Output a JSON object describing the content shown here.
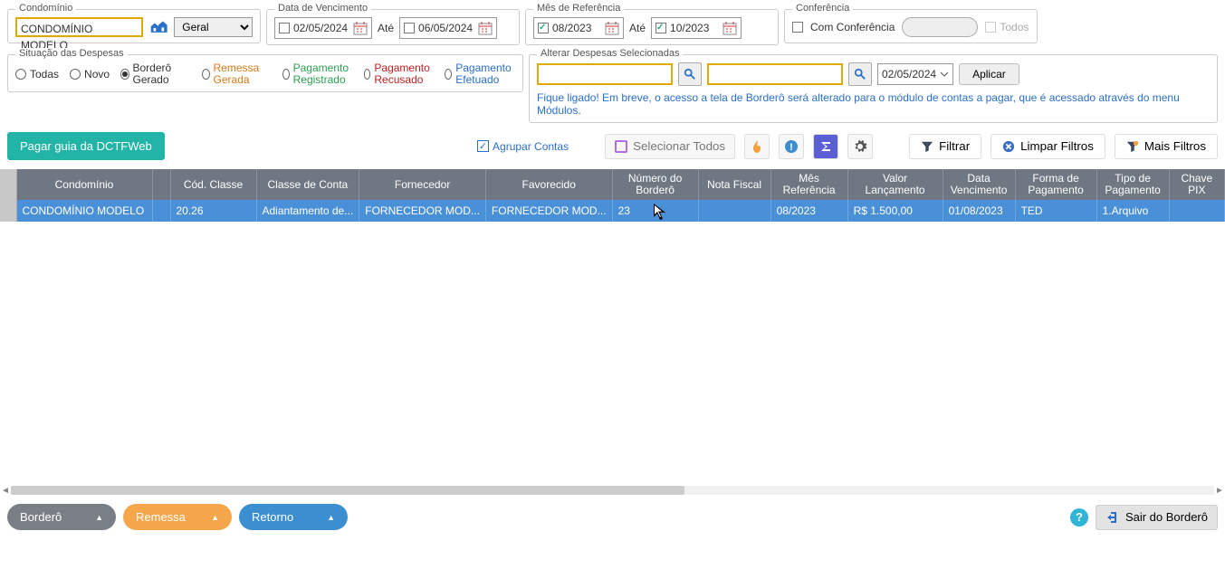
{
  "condominio": {
    "legend": "Condomínio",
    "name": "CONDOMÍNIO MODELO",
    "tipo": "Geral"
  },
  "dataVencimento": {
    "legend": "Data de Vencimento",
    "from": "02/05/2024",
    "to": "06/05/2024",
    "ate": "Até",
    "fromChecked": false,
    "toChecked": false
  },
  "mesReferencia": {
    "legend": "Mês de Referência",
    "from": "08/2023",
    "to": "10/2023",
    "ate": "Até"
  },
  "conferencia": {
    "legend": "Conferência",
    "label": "Com Conferência",
    "todos": "Todos"
  },
  "situacao": {
    "legend": "Situação das Despesas",
    "options": {
      "todas": "Todas",
      "novo": "Novo",
      "bordero": "Borderô Gerado",
      "remessa": "Remessa Gerada",
      "registrado": "Pagamento Registrado",
      "recusado": "Pagamento Recusado",
      "efetuado": "Pagamento Efetuado"
    },
    "selected": "bordero",
    "colors": {
      "remessa": "#d97b1c",
      "registrado": "#2a9f52",
      "recusado": "#c02020",
      "efetuado": "#2a6fc9"
    }
  },
  "alterar": {
    "legend": "Alterar Despesas Selecionadas",
    "date": "02/05/2024",
    "aplicar": "Aplicar",
    "notice": "Fique ligado! Em breve, o acesso a tela de Borderô será alterado para o módulo de contas a pagar, que é acessado através do menu Módulos."
  },
  "actions": {
    "pagarGuia": "Pagar guia da DCTFWeb",
    "agruparContas": "Agrupar Contas",
    "selecionarTodos": "Selecionar Todos",
    "filtrar": "Filtrar",
    "limparFiltros": "Limpar Filtros",
    "maisFiltros": "Mais Filtros"
  },
  "table": {
    "headers": {
      "condominio": "Condomínio",
      "codClasse": "Cód. Classe",
      "classeConta": "Classe de Conta",
      "fornecedor": "Fornecedor",
      "favorecido": "Favorecido",
      "numBordero": "Número do Borderô",
      "notaFiscal": "Nota Fiscal",
      "mesRef": "Mês Referência",
      "valorLanc": "Valor Lançamento",
      "dataVenc": "Data Vencimento",
      "formaPag": "Forma de Pagamento",
      "tipoPag": "Tipo de Pagamento",
      "chavePix": "Chave PIX"
    },
    "rows": [
      {
        "condominio": "CONDOMÍNIO MODELO",
        "codClasse": "20.26",
        "classeConta": "Adiantamento de...",
        "fornecedor": "FORNECEDOR MOD...",
        "favorecido": "FORNECEDOR MOD...",
        "numBordero": "23",
        "notaFiscal": "",
        "mesRef": "08/2023",
        "valorLanc": "R$ 1.500,00",
        "dataVenc": "01/08/2023",
        "formaPag": "TED",
        "tipoPag": "1.Arquivo",
        "chavePix": ""
      }
    ]
  },
  "footer": {
    "bordero": "Borderô",
    "remessa": "Remessa",
    "retorno": "Retorno",
    "sair": "Sair do Borderô"
  }
}
